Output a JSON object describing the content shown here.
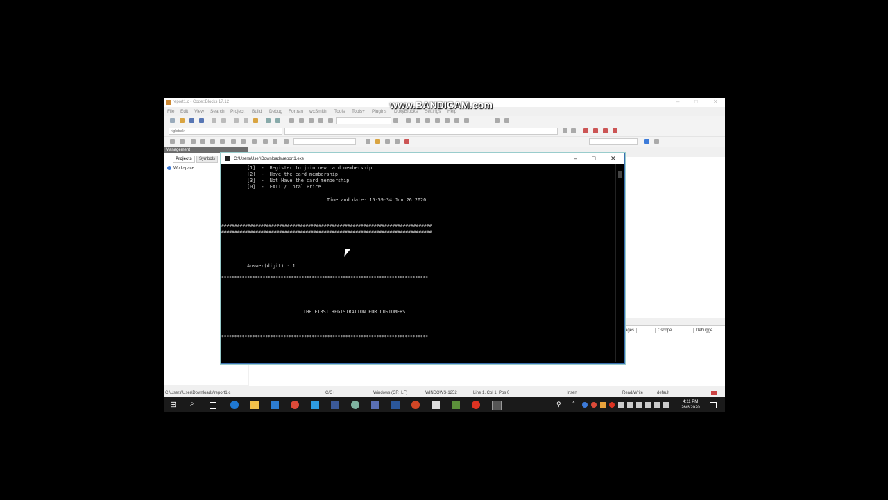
{
  "watermark": "www.BANDICAM.com",
  "ide": {
    "title": "report1.c - Code::Blocks 17.12",
    "menu": [
      "File",
      "Edit",
      "View",
      "Search",
      "Project",
      "Build",
      "Debug",
      "Fortran",
      "wxSmith",
      "Tools",
      "Tools+",
      "Plugins",
      "DoxyBlocks",
      "Settings",
      "Help"
    ],
    "scope_combo": "<global>",
    "management": {
      "header": "Management",
      "tabs": [
        "Projects",
        "Symbols"
      ],
      "workspace": "Workspace"
    },
    "log_tabs": [
      "ages",
      "Cscope",
      "Debugge"
    ],
    "status": {
      "path": "C:\\Users\\User\\Downloads\\report1.c",
      "language": "C/C++",
      "eol": "Windows (CR+LF)",
      "encoding": "WINDOWS-1252",
      "position": "Line 1, Col 1, Pos 0",
      "mode": "Insert",
      "access": "Read/Write",
      "profile": "default"
    }
  },
  "console": {
    "title": "C:\\Users\\User\\Downloads\\report1.exe",
    "lines": {
      "opt1": "[1]  -  Register to join new card membership",
      "opt2": "[2]  -  Have the card membership",
      "opt3": "[3]  -  Not Have the card membership",
      "opt0": "[0]  -  EXIT / Total Price",
      "time": "Time and date: 15:59:34 Jun 26 2020",
      "hash": "################################################################################",
      "answer": "Answer(digit) : 1",
      "star": "********************************************************************************",
      "heading": "THE FIRST REGISTRATION FOR CUSTOMERS"
    }
  },
  "taskbar": {
    "time": "4:11 PM",
    "date": "26/6/2020"
  }
}
